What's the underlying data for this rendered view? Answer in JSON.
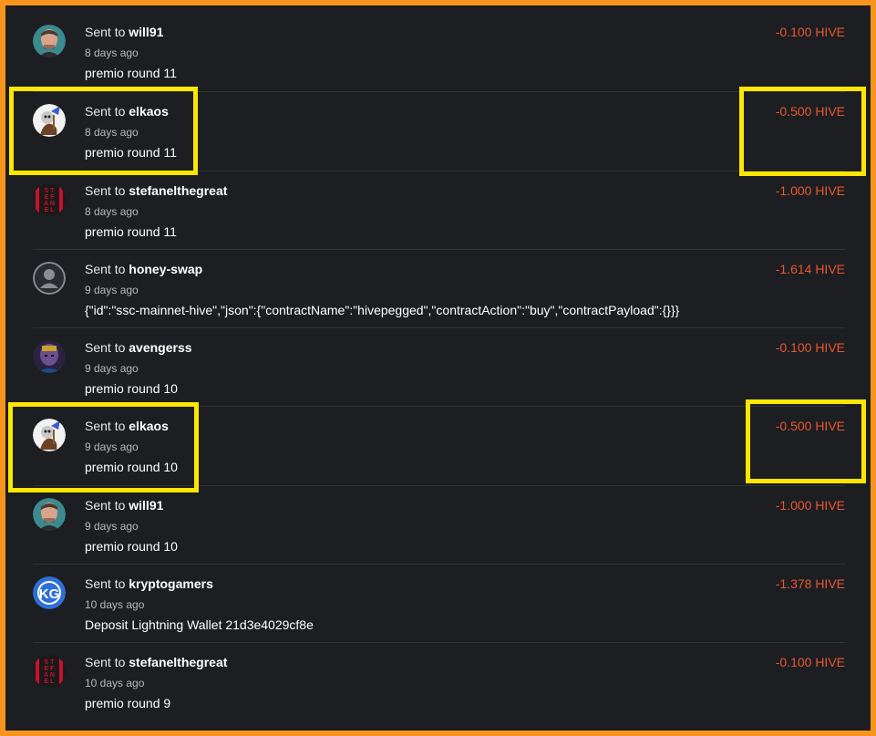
{
  "colors": {
    "accent_negative": "#e9572f",
    "highlight": "#ffe600",
    "background": "#1c1e21",
    "frame": "#f7941d"
  },
  "transactions": [
    {
      "prefix": "Sent to",
      "user": "will91",
      "time": "8 days ago",
      "memo": "premio round 11",
      "amount": "-0.100 HIVE",
      "avatar_icon": "person-photo-avatar-icon"
    },
    {
      "prefix": "Sent to",
      "user": "elkaos",
      "time": "8 days ago",
      "memo": "premio round 11",
      "amount": "-0.500 HIVE",
      "avatar_icon": "cartoon-character-avatar-icon"
    },
    {
      "prefix": "Sent to",
      "user": "stefanelthegreat",
      "time": "8 days ago",
      "memo": "premio round 11",
      "amount": "-1.000 HIVE",
      "avatar_icon": "stefanel-logo-avatar-icon"
    },
    {
      "prefix": "Sent to",
      "user": "honey-swap",
      "time": "9 days ago",
      "memo": "{\"id\":\"ssc-mainnet-hive\",\"json\":{\"contractName\":\"hivepegged\",\"contractAction\":\"buy\",\"contractPayload\":{}}}",
      "amount": "-1.614 HIVE",
      "avatar_icon": "default-user-avatar-icon"
    },
    {
      "prefix": "Sent to",
      "user": "avengerss",
      "time": "9 days ago",
      "memo": "premio round 10",
      "amount": "-0.100 HIVE",
      "avatar_icon": "villain-avatar-icon"
    },
    {
      "prefix": "Sent to",
      "user": "elkaos",
      "time": "9 days ago",
      "memo": "premio round 10",
      "amount": "-0.500 HIVE",
      "avatar_icon": "cartoon-character-avatar-icon"
    },
    {
      "prefix": "Sent to",
      "user": "will91",
      "time": "9 days ago",
      "memo": "premio round 10",
      "amount": "-1.000 HIVE",
      "avatar_icon": "person-photo-avatar-icon"
    },
    {
      "prefix": "Sent to",
      "user": "kryptogamers",
      "time": "10 days ago",
      "memo": "Deposit Lightning Wallet 21d3e4029cf8e",
      "amount": "-1.378 HIVE",
      "avatar_icon": "kg-logo-avatar-icon"
    },
    {
      "prefix": "Sent to",
      "user": "stefanelthegreat",
      "time": "10 days ago",
      "memo": "premio round 9",
      "amount": "-0.100 HIVE",
      "avatar_icon": "stefanel-logo-avatar-icon"
    }
  ]
}
